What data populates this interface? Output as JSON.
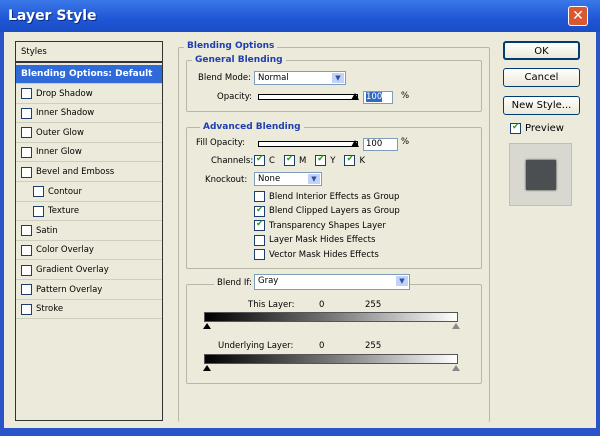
{
  "window": {
    "title": "Layer Style",
    "close": "✕"
  },
  "styles": {
    "header": "Styles",
    "items": [
      {
        "label": "Blending Options: Default",
        "selected": true
      },
      {
        "label": "Drop Shadow",
        "checked": false
      },
      {
        "label": "Inner Shadow",
        "checked": false
      },
      {
        "label": "Outer Glow",
        "checked": false
      },
      {
        "label": "Inner Glow",
        "checked": false
      },
      {
        "label": "Bevel and Emboss",
        "checked": false
      },
      {
        "label": "Contour",
        "checked": false,
        "sub": true
      },
      {
        "label": "Texture",
        "checked": false,
        "sub": true
      },
      {
        "label": "Satin",
        "checked": false
      },
      {
        "label": "Color Overlay",
        "checked": false
      },
      {
        "label": "Gradient Overlay",
        "checked": false
      },
      {
        "label": "Pattern Overlay",
        "checked": false
      },
      {
        "label": "Stroke",
        "checked": false
      }
    ]
  },
  "blending": {
    "title": "Blending Options",
    "general": {
      "title": "General Blending",
      "blend_mode_label": "Blend Mode:",
      "blend_mode": "Normal",
      "opacity_label": "Opacity:",
      "opacity": "100",
      "percent": "%"
    },
    "advanced": {
      "title": "Advanced Blending",
      "fill_label": "Fill Opacity:",
      "fill": "100",
      "percent": "%",
      "channels_label": "Channels:",
      "channels": [
        "C",
        "M",
        "Y",
        "K"
      ],
      "knockout_label": "Knockout:",
      "knockout": "None",
      "options": [
        {
          "label": "Blend Interior Effects as Group",
          "checked": false
        },
        {
          "label": "Blend Clipped Layers as Group",
          "checked": true
        },
        {
          "label": "Transparency Shapes Layer",
          "checked": true
        },
        {
          "label": "Layer Mask Hides Effects",
          "checked": false
        },
        {
          "label": "Vector Mask Hides Effects",
          "checked": false
        }
      ]
    },
    "blend_if": {
      "label": "Blend If:",
      "value": "Gray",
      "this_layer": "This Layer:",
      "underlying": "Underlying Layer:",
      "min": "0",
      "max": "255"
    }
  },
  "buttons": {
    "ok": "OK",
    "cancel": "Cancel",
    "new_style": "New Style...",
    "preview": "Preview"
  }
}
